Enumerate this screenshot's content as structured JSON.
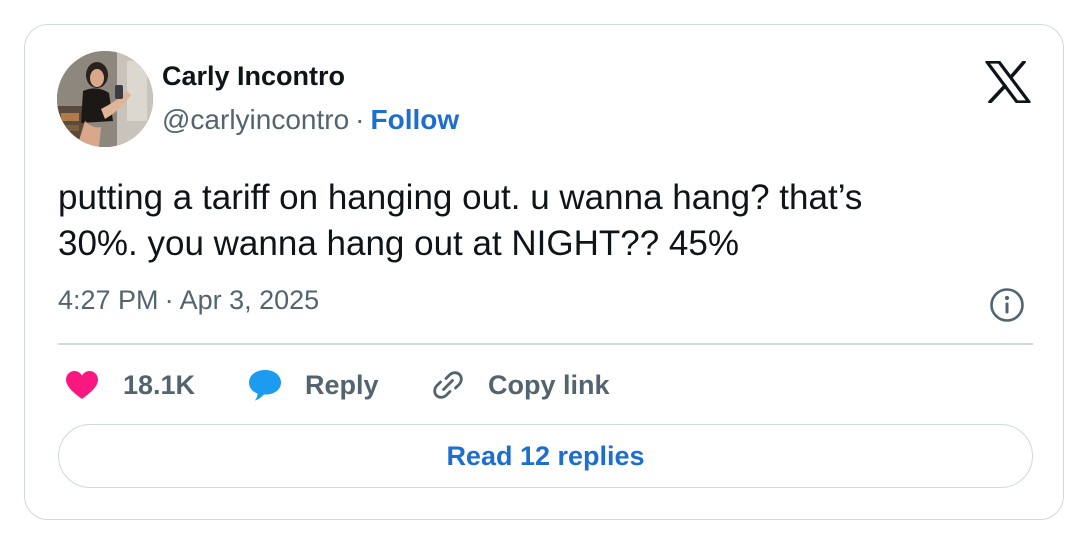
{
  "author": {
    "name": "Carly Incontro",
    "handle": "@carlyincontro",
    "separator": "·",
    "follow_label": "Follow"
  },
  "tweet": {
    "text_line1": "putting a tariff on hanging out. u wanna hang? that’s",
    "text_line2": "30%. you wanna hang out at NIGHT?? 45%",
    "time": "4:27 PM",
    "separator": "·",
    "date": "Apr 3, 2025"
  },
  "actions": {
    "likes_count": "18.1K",
    "reply_label": "Reply",
    "copy_link_label": "Copy link"
  },
  "read_replies_label": "Read 12 replies",
  "icons": {
    "brand": "x-logo-icon",
    "info": "info-icon",
    "like": "heart-icon",
    "reply": "speech-bubble-icon",
    "copy": "link-icon"
  },
  "colors": {
    "heart": "#f91880",
    "reply_bubble": "#1d9bf0",
    "link_blue": "#1d6fcf",
    "text_primary": "#0f1419",
    "text_secondary": "#536471",
    "border": "#cfd9de"
  }
}
